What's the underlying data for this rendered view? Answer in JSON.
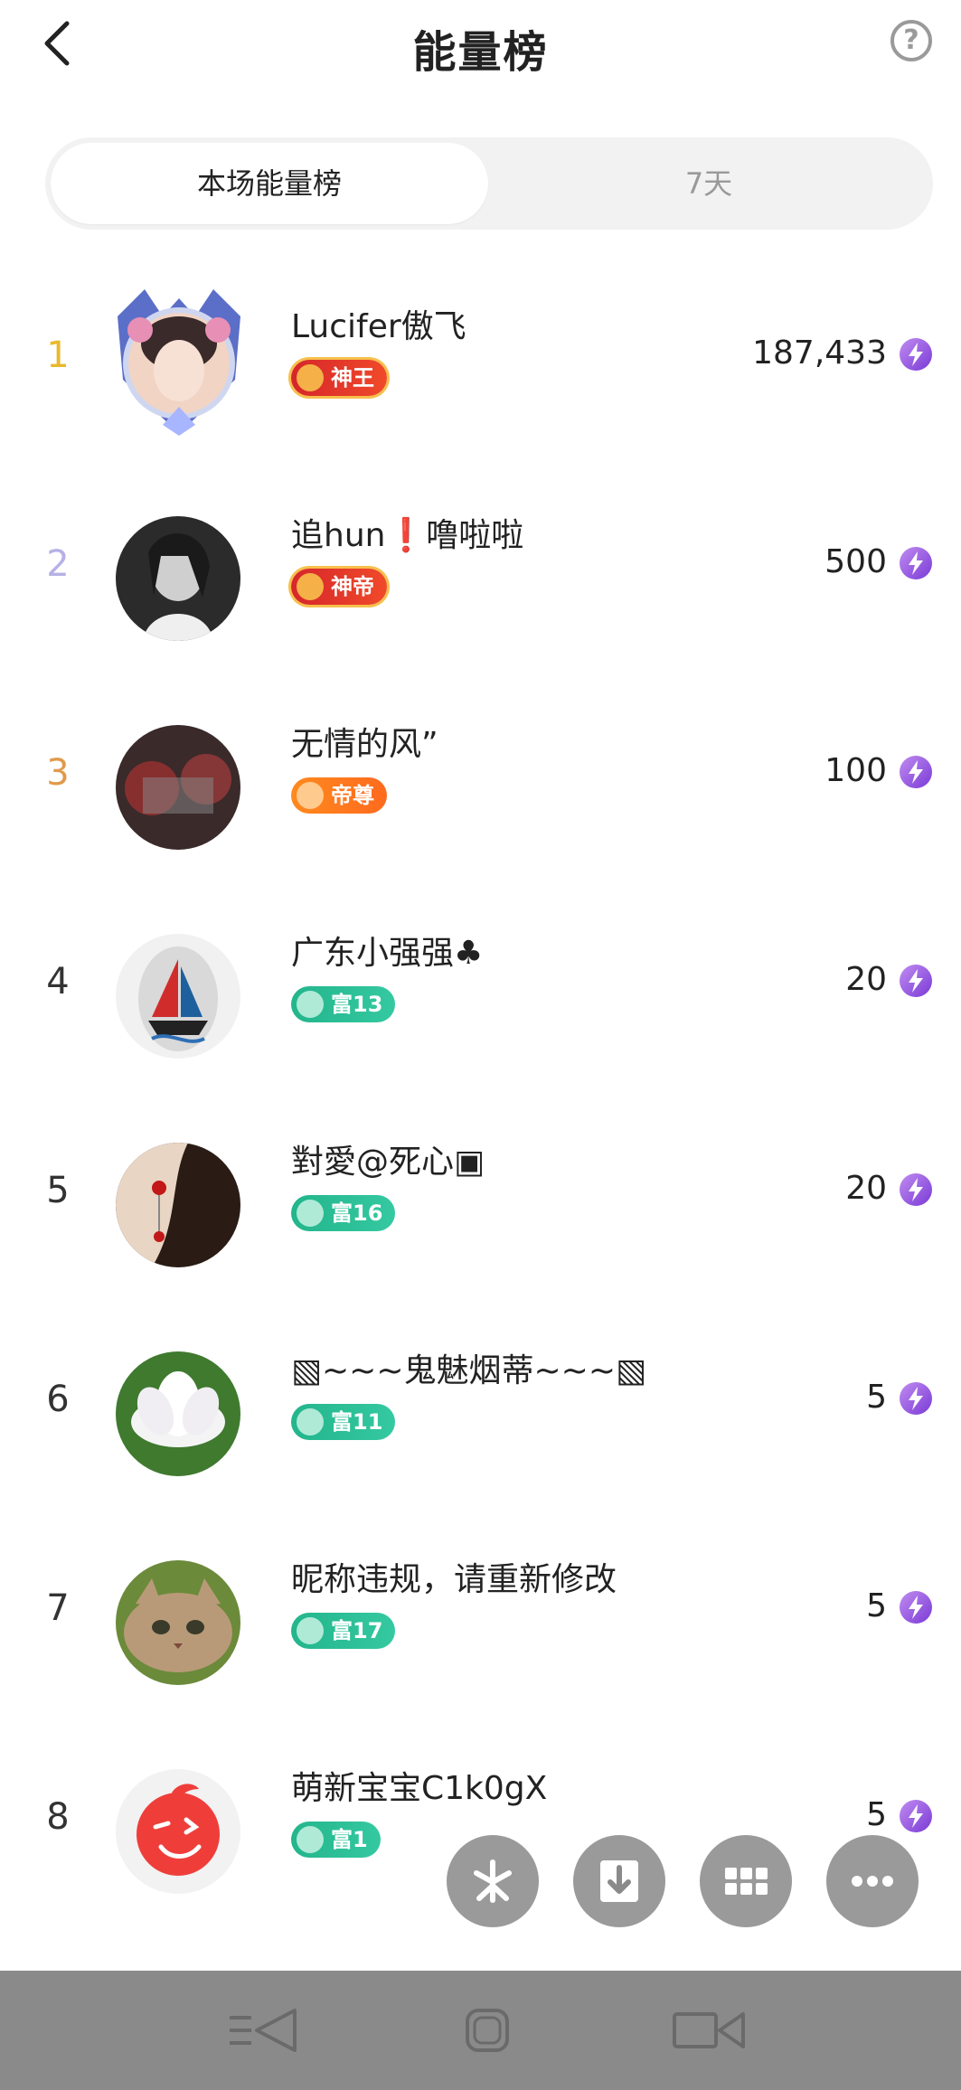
{
  "header": {
    "title": "能量榜",
    "help_symbol": "?"
  },
  "tabs": [
    {
      "label": "本场能量榜",
      "active": true
    },
    {
      "label": "7天",
      "active": false
    }
  ],
  "ranking": [
    {
      "rank": "1",
      "name": "Lucifer傲飞",
      "badge": "神王",
      "badge_style": "red",
      "score": "187,433"
    },
    {
      "rank": "2",
      "name": "追hun❗噜啦啦",
      "badge": "神帝",
      "badge_style": "red",
      "score": "500"
    },
    {
      "rank": "3",
      "name": "无情的风”",
      "badge": "帝尊",
      "badge_style": "orange",
      "score": "100"
    },
    {
      "rank": "4",
      "name": "广东小强强♣",
      "badge": "富13",
      "badge_style": "green",
      "score": "20"
    },
    {
      "rank": "5",
      "name": "對愛@死心▣",
      "badge": "富16",
      "badge_style": "green",
      "score": "20"
    },
    {
      "rank": "6",
      "name": "▧~~~鬼魅烟蒂~~~▧",
      "badge": "富11",
      "badge_style": "green",
      "score": "5"
    },
    {
      "rank": "7",
      "name": "昵称违规，请重新修改",
      "badge": "富17",
      "badge_style": "green",
      "score": "5"
    },
    {
      "rank": "8",
      "name": "萌新宝宝C1k0gX",
      "badge": "富1",
      "badge_style": "green",
      "score": "5"
    }
  ],
  "colors": {
    "rank1": "#e8b92c",
    "rank2": "#b6b1e6",
    "rank3": "#e09a4c",
    "energy": "#8a45dc"
  },
  "icons": {
    "back": "chevron-left-icon",
    "help": "question-circle-icon",
    "energy": "lightning-icon",
    "fabs": [
      "pinwheel-icon",
      "download-icon",
      "grid-icon",
      "more-icon"
    ],
    "system_nav": [
      "menu-back-icon",
      "home-icon",
      "camera-icon"
    ]
  }
}
